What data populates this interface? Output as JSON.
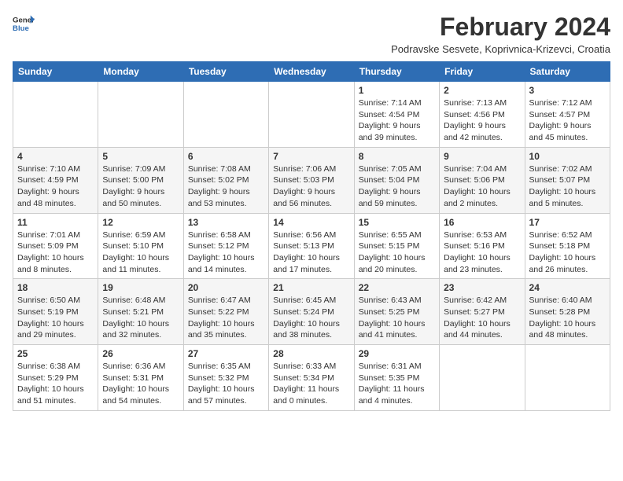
{
  "header": {
    "logo_line1": "General",
    "logo_line2": "Blue",
    "month_year": "February 2024",
    "location": "Podravske Sesvete, Koprivnica-Krizevci, Croatia"
  },
  "days_of_week": [
    "Sunday",
    "Monday",
    "Tuesday",
    "Wednesday",
    "Thursday",
    "Friday",
    "Saturday"
  ],
  "weeks": [
    [
      {
        "day": "",
        "info": ""
      },
      {
        "day": "",
        "info": ""
      },
      {
        "day": "",
        "info": ""
      },
      {
        "day": "",
        "info": ""
      },
      {
        "day": "1",
        "info": "Sunrise: 7:14 AM\nSunset: 4:54 PM\nDaylight: 9 hours\nand 39 minutes."
      },
      {
        "day": "2",
        "info": "Sunrise: 7:13 AM\nSunset: 4:56 PM\nDaylight: 9 hours\nand 42 minutes."
      },
      {
        "day": "3",
        "info": "Sunrise: 7:12 AM\nSunset: 4:57 PM\nDaylight: 9 hours\nand 45 minutes."
      }
    ],
    [
      {
        "day": "4",
        "info": "Sunrise: 7:10 AM\nSunset: 4:59 PM\nDaylight: 9 hours\nand 48 minutes."
      },
      {
        "day": "5",
        "info": "Sunrise: 7:09 AM\nSunset: 5:00 PM\nDaylight: 9 hours\nand 50 minutes."
      },
      {
        "day": "6",
        "info": "Sunrise: 7:08 AM\nSunset: 5:02 PM\nDaylight: 9 hours\nand 53 minutes."
      },
      {
        "day": "7",
        "info": "Sunrise: 7:06 AM\nSunset: 5:03 PM\nDaylight: 9 hours\nand 56 minutes."
      },
      {
        "day": "8",
        "info": "Sunrise: 7:05 AM\nSunset: 5:04 PM\nDaylight: 9 hours\nand 59 minutes."
      },
      {
        "day": "9",
        "info": "Sunrise: 7:04 AM\nSunset: 5:06 PM\nDaylight: 10 hours\nand 2 minutes."
      },
      {
        "day": "10",
        "info": "Sunrise: 7:02 AM\nSunset: 5:07 PM\nDaylight: 10 hours\nand 5 minutes."
      }
    ],
    [
      {
        "day": "11",
        "info": "Sunrise: 7:01 AM\nSunset: 5:09 PM\nDaylight: 10 hours\nand 8 minutes."
      },
      {
        "day": "12",
        "info": "Sunrise: 6:59 AM\nSunset: 5:10 PM\nDaylight: 10 hours\nand 11 minutes."
      },
      {
        "day": "13",
        "info": "Sunrise: 6:58 AM\nSunset: 5:12 PM\nDaylight: 10 hours\nand 14 minutes."
      },
      {
        "day": "14",
        "info": "Sunrise: 6:56 AM\nSunset: 5:13 PM\nDaylight: 10 hours\nand 17 minutes."
      },
      {
        "day": "15",
        "info": "Sunrise: 6:55 AM\nSunset: 5:15 PM\nDaylight: 10 hours\nand 20 minutes."
      },
      {
        "day": "16",
        "info": "Sunrise: 6:53 AM\nSunset: 5:16 PM\nDaylight: 10 hours\nand 23 minutes."
      },
      {
        "day": "17",
        "info": "Sunrise: 6:52 AM\nSunset: 5:18 PM\nDaylight: 10 hours\nand 26 minutes."
      }
    ],
    [
      {
        "day": "18",
        "info": "Sunrise: 6:50 AM\nSunset: 5:19 PM\nDaylight: 10 hours\nand 29 minutes."
      },
      {
        "day": "19",
        "info": "Sunrise: 6:48 AM\nSunset: 5:21 PM\nDaylight: 10 hours\nand 32 minutes."
      },
      {
        "day": "20",
        "info": "Sunrise: 6:47 AM\nSunset: 5:22 PM\nDaylight: 10 hours\nand 35 minutes."
      },
      {
        "day": "21",
        "info": "Sunrise: 6:45 AM\nSunset: 5:24 PM\nDaylight: 10 hours\nand 38 minutes."
      },
      {
        "day": "22",
        "info": "Sunrise: 6:43 AM\nSunset: 5:25 PM\nDaylight: 10 hours\nand 41 minutes."
      },
      {
        "day": "23",
        "info": "Sunrise: 6:42 AM\nSunset: 5:27 PM\nDaylight: 10 hours\nand 44 minutes."
      },
      {
        "day": "24",
        "info": "Sunrise: 6:40 AM\nSunset: 5:28 PM\nDaylight: 10 hours\nand 48 minutes."
      }
    ],
    [
      {
        "day": "25",
        "info": "Sunrise: 6:38 AM\nSunset: 5:29 PM\nDaylight: 10 hours\nand 51 minutes."
      },
      {
        "day": "26",
        "info": "Sunrise: 6:36 AM\nSunset: 5:31 PM\nDaylight: 10 hours\nand 54 minutes."
      },
      {
        "day": "27",
        "info": "Sunrise: 6:35 AM\nSunset: 5:32 PM\nDaylight: 10 hours\nand 57 minutes."
      },
      {
        "day": "28",
        "info": "Sunrise: 6:33 AM\nSunset: 5:34 PM\nDaylight: 11 hours\nand 0 minutes."
      },
      {
        "day": "29",
        "info": "Sunrise: 6:31 AM\nSunset: 5:35 PM\nDaylight: 11 hours\nand 4 minutes."
      },
      {
        "day": "",
        "info": ""
      },
      {
        "day": "",
        "info": ""
      }
    ]
  ]
}
